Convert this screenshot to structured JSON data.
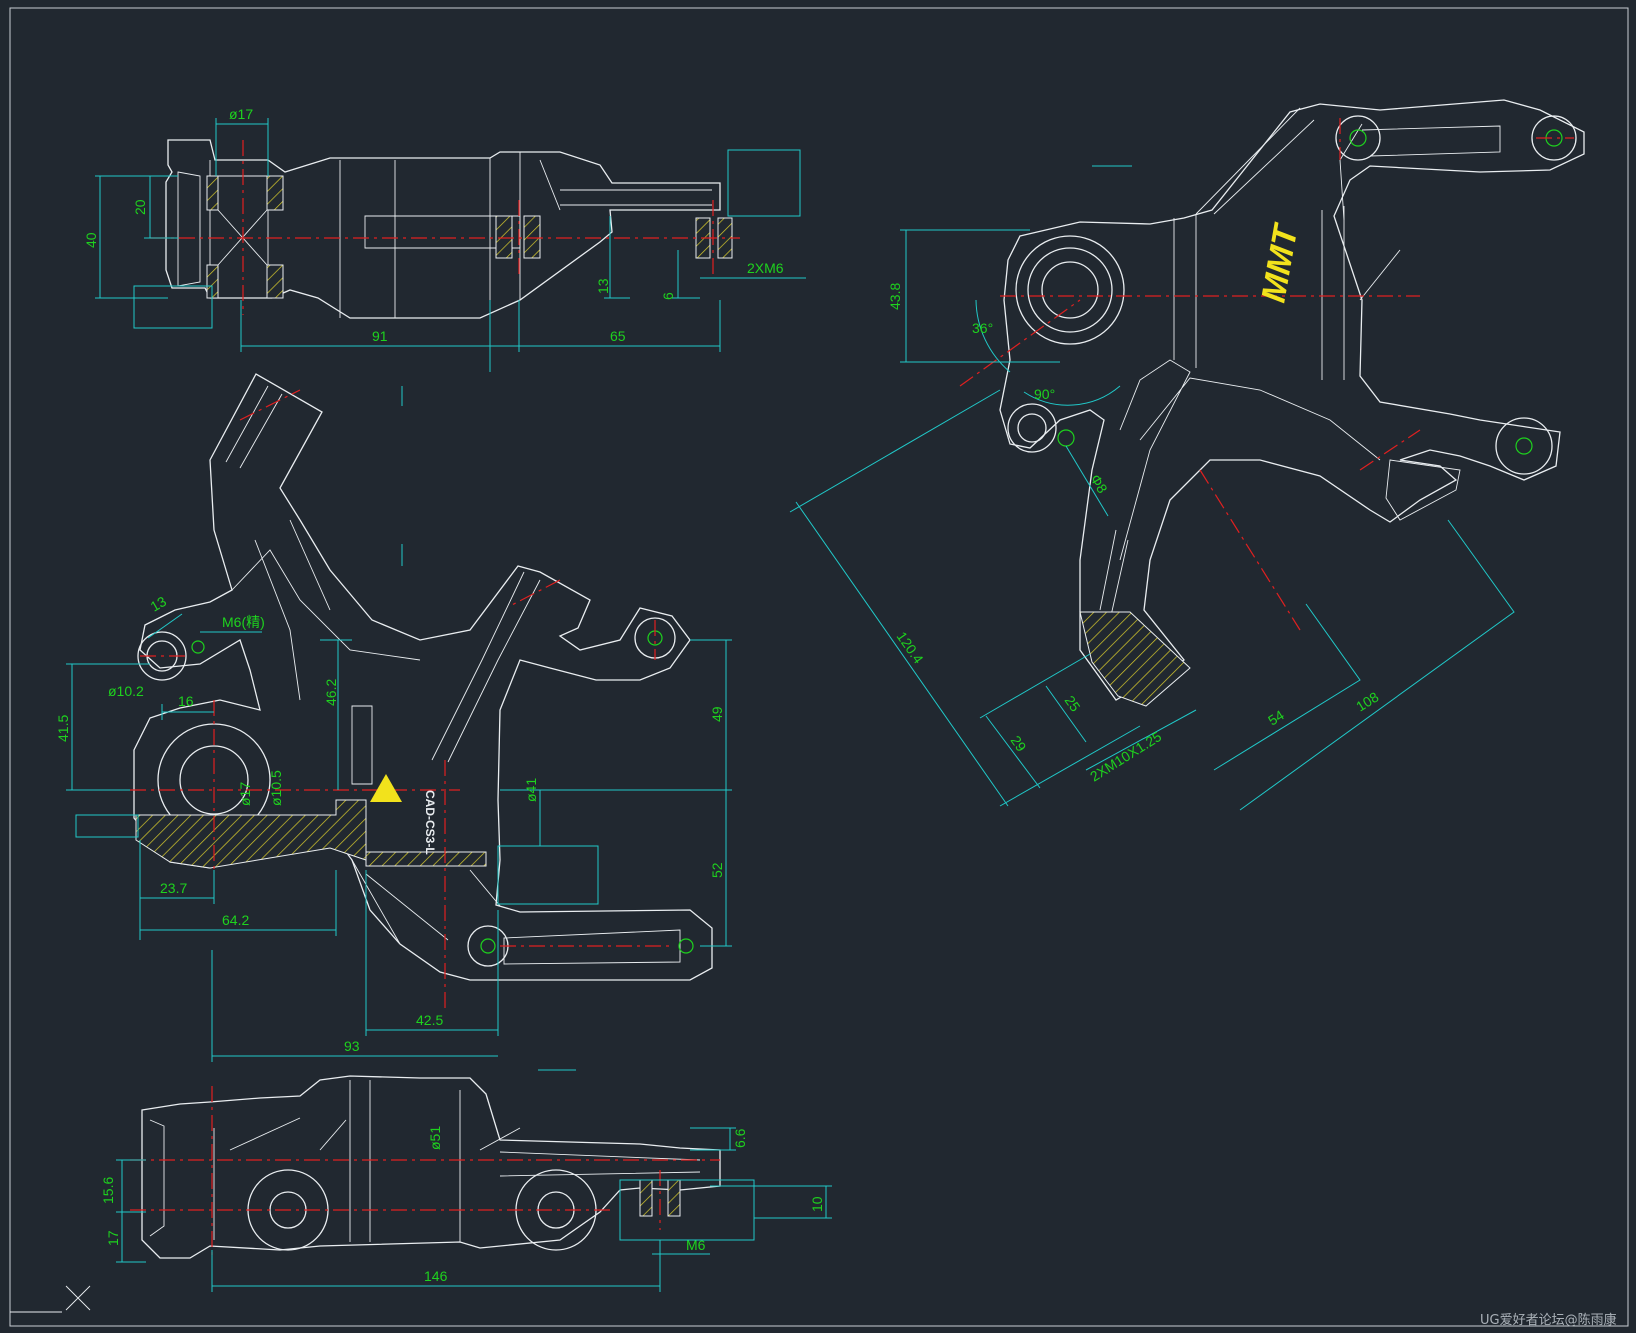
{
  "top_view": {
    "dims": [
      "ø17",
      "20",
      "40",
      "13",
      "6",
      "2XM6",
      "91",
      "65"
    ]
  },
  "side_view": {
    "dims": [
      "13",
      "M6(精)",
      "ø10.2",
      "16",
      "41.5",
      "46.2",
      "ø17",
      "ø10.5",
      "23.7",
      "64.2",
      "49",
      "ø41",
      "52",
      "42.5",
      "93"
    ],
    "part_marking": "CAD-CS3-L"
  },
  "bottom_view": {
    "dims": [
      "ø51",
      "6.6",
      "15.6",
      "17",
      "10",
      "M6",
      "146"
    ]
  },
  "iso_view": {
    "dims": [
      "43.8",
      "36°",
      "90°",
      "120.4",
      "29",
      "25",
      "2XM10X1.25",
      "54",
      "108",
      "Φ8"
    ],
    "logo": "MMT"
  },
  "watermark": "UG爱好者论坛@陈雨康"
}
